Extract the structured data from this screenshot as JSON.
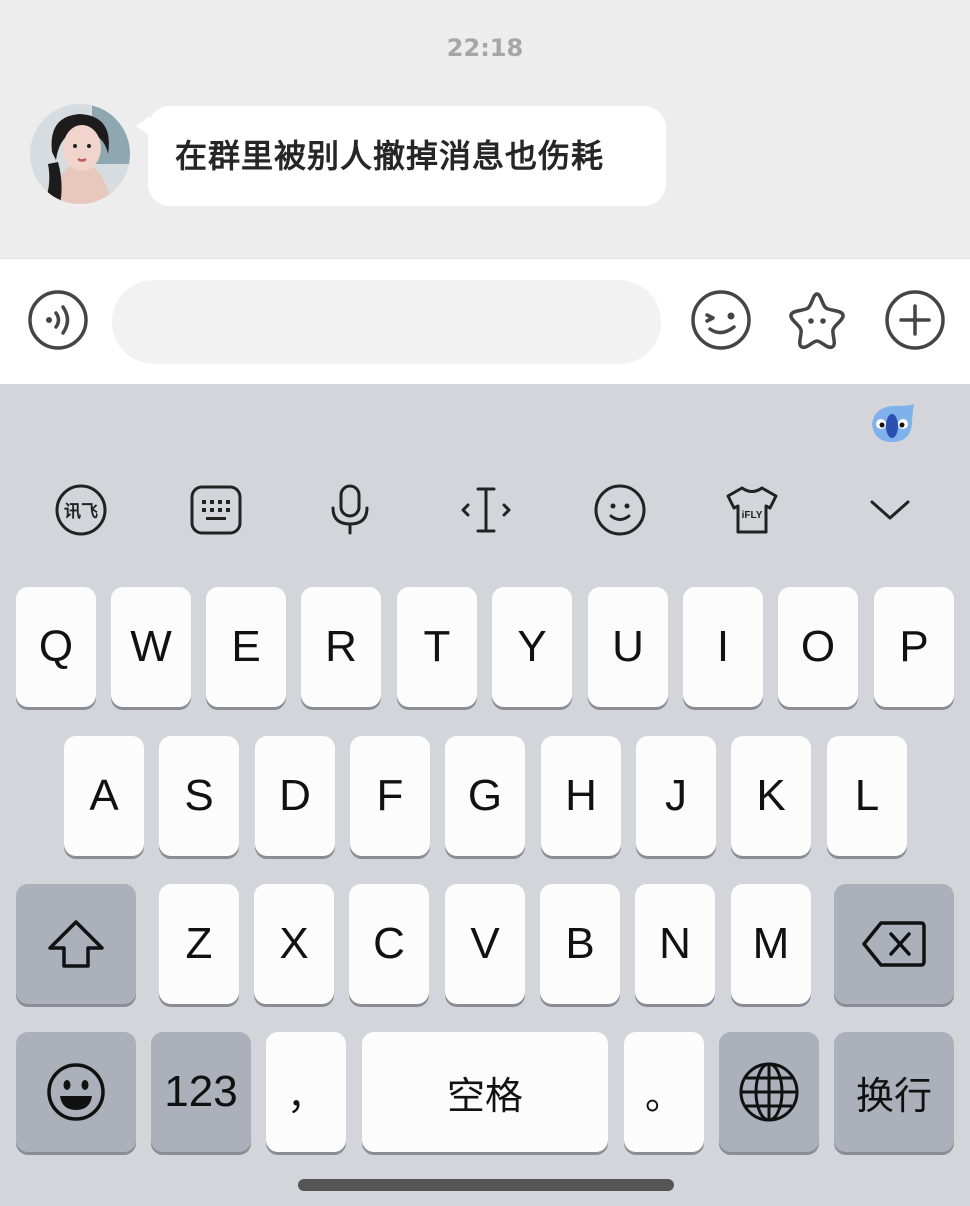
{
  "chat": {
    "timestamp": "22:18",
    "message": "在群里被别人撤掉消息也伤耗"
  },
  "input_bar": {
    "text_value": "",
    "icons": [
      "voice-input-icon",
      "emoji-icon",
      "sticker-star-icon",
      "add-icon"
    ]
  },
  "keyboard": {
    "toolbar_icons": [
      "ifly-brand-icon",
      "keyboard-switch-icon",
      "microphone-icon",
      "cursor-move-icon",
      "emoji-face-icon",
      "skin-theme-icon",
      "collapse-chevron-icon"
    ],
    "toolbar_labels": {
      "brand": "讯飞",
      "skin": "iFLY"
    },
    "row1": [
      "Q",
      "W",
      "E",
      "R",
      "T",
      "Y",
      "U",
      "I",
      "O",
      "P"
    ],
    "row2": [
      "A",
      "S",
      "D",
      "F",
      "G",
      "H",
      "J",
      "K",
      "L"
    ],
    "row3": [
      "Z",
      "X",
      "C",
      "V",
      "B",
      "N",
      "M"
    ],
    "bottom": {
      "numbers": "123",
      "comma": "，",
      "space": "空格",
      "period": "。",
      "return": "换行"
    }
  }
}
